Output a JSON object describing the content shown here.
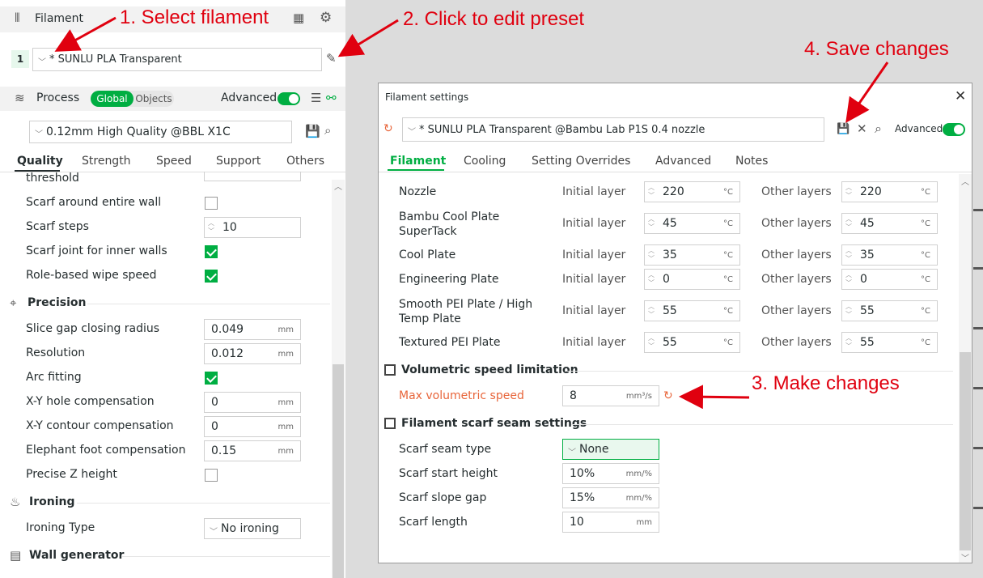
{
  "filament_panel": {
    "title": "Filament",
    "slot_number": "1",
    "preset": "* SUNLU PLA Transparent"
  },
  "process_panel": {
    "title": "Process",
    "toggle_global": "Global",
    "toggle_objects": "Objects",
    "advanced_label": "Advanced",
    "preset": "0.12mm High Quality @BBL X1C",
    "tabs": [
      "Quality",
      "Strength",
      "Speed",
      "Support",
      "Others"
    ],
    "partial_top_label": "threshold",
    "rows_wall": [
      {
        "label": "Scarf around entire wall"
      },
      {
        "label": "Scarf steps",
        "value": "10"
      },
      {
        "label": "Scarf joint for inner walls"
      },
      {
        "label": "Role-based wipe speed"
      }
    ],
    "section_precision": "Precision",
    "precision_rows": [
      {
        "label": "Slice gap closing radius",
        "value": "0.049",
        "unit": "mm"
      },
      {
        "label": "Resolution",
        "value": "0.012",
        "unit": "mm"
      },
      {
        "label": "Arc fitting"
      },
      {
        "label": "X-Y hole compensation",
        "value": "0",
        "unit": "mm"
      },
      {
        "label": "X-Y contour compensation",
        "value": "0",
        "unit": "mm"
      },
      {
        "label": "Elephant foot compensation",
        "value": "0.15",
        "unit": "mm"
      },
      {
        "label": "Precise Z height"
      }
    ],
    "section_ironing": "Ironing",
    "ironing_type_label": "Ironing Type",
    "ironing_type_value": "No ironing",
    "section_wall_generator": "Wall generator"
  },
  "dialog": {
    "title": "Filament settings",
    "preset": "* SUNLU PLA Transparent @Bambu Lab P1S 0.4 nozzle",
    "advanced_label": "Advanced",
    "tabs": [
      "Filament",
      "Cooling",
      "Setting Overrides",
      "Advanced",
      "Notes"
    ],
    "initial_label": "Initial layer",
    "other_label": "Other layers",
    "temp_unit": "°C",
    "temp_rows": [
      {
        "label": "Nozzle",
        "initial": "220",
        "other": "220"
      },
      {
        "label": "Bambu Cool Plate SuperTack",
        "initial": "45",
        "other": "45"
      },
      {
        "label": "Cool Plate",
        "initial": "35",
        "other": "35"
      },
      {
        "label": "Engineering Plate",
        "initial": "0",
        "other": "0"
      },
      {
        "label": "Smooth PEI Plate / High Temp Plate",
        "initial": "55",
        "other": "55"
      },
      {
        "label": "Textured PEI Plate",
        "initial": "55",
        "other": "55"
      }
    ],
    "section_volumetric": "Volumetric speed limitation",
    "max_vol_label": "Max volumetric speed",
    "max_vol_value": "8",
    "max_vol_unit": "mm³/s",
    "section_scarf": "Filament scarf seam settings",
    "scarf_type_label": "Scarf seam type",
    "scarf_type_value": "None",
    "scarf_start_label": "Scarf start height",
    "scarf_start_value": "10%",
    "scarf_start_unit": "mm/%",
    "scarf_gap_label": "Scarf slope gap",
    "scarf_gap_value": "15%",
    "scarf_gap_unit": "mm/%",
    "scarf_length_label": "Scarf length",
    "scarf_length_value": "10",
    "scarf_length_unit": "mm"
  },
  "annotations": {
    "step1": "1.  Select filament",
    "step2": "2. Click to edit preset",
    "step3": "3. Make changes",
    "step4": "4. Save changes"
  },
  "colors": {
    "accent_green": "#00ae42",
    "annotation_red": "#e0000f",
    "modified_orange": "#e8653a"
  }
}
